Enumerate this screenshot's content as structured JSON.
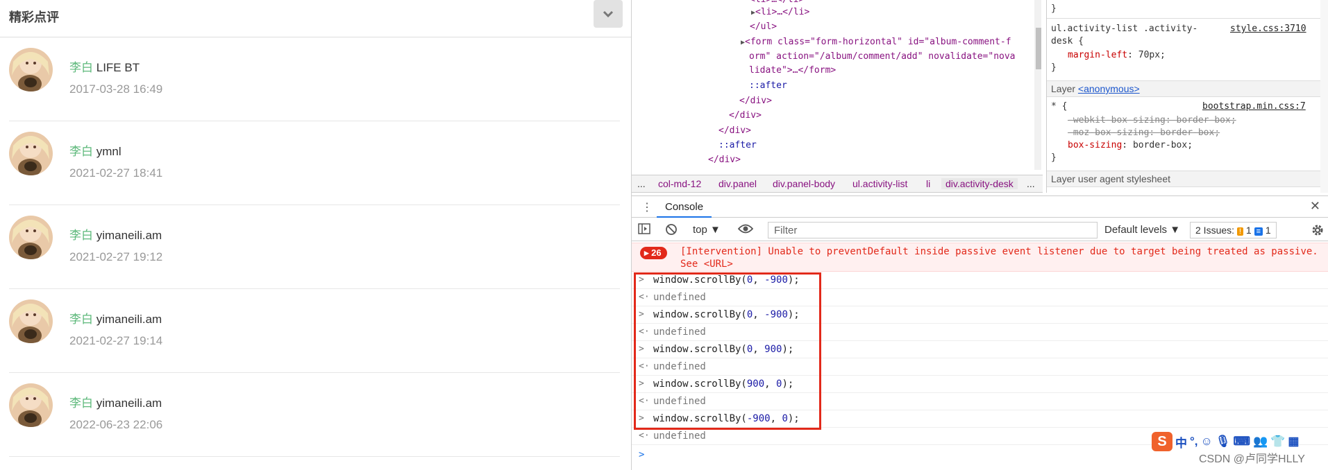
{
  "page": {
    "panel_title": "精彩点评",
    "comments": [
      {
        "user": "李白",
        "content": "LIFE BT",
        "time": "2017-03-28 16:49"
      },
      {
        "user": "李白",
        "content": "ymnl",
        "time": "2021-02-27 18:41"
      },
      {
        "user": "李白",
        "content": "yimaneili.am",
        "time": "2021-02-27 19:12"
      },
      {
        "user": "李白",
        "content": "yimaneili.am",
        "time": "2021-02-27 19:14"
      },
      {
        "user": "李白",
        "content": "yimaneili.am",
        "time": "2022-06-23 22:06"
      }
    ]
  },
  "elements": {
    "lines": [
      {
        "text": "<li>…</li>"
      },
      {
        "text": "</ul>"
      },
      {
        "form_open": "<form class=\"form-horizontal\" id=\"album-comment-f",
        "form_cont1": "orm\" action=\"/album/comment/add\" novalidate=\"nova",
        "form_cont2": "lidate\">…</form>"
      },
      {
        "text": "::after"
      },
      {
        "text": "</div>"
      },
      {
        "text": "</div>"
      },
      {
        "text": "</div>"
      },
      {
        "text": "::after"
      },
      {
        "text": "</div>"
      }
    ]
  },
  "breadcrumb": [
    "...",
    "col-md-12",
    "div.panel",
    "div.panel-body",
    "ul.activity-list",
    "li",
    "div.activity-desk",
    "..."
  ],
  "styles": {
    "rule1_selector_a": "ul.activity-list .activity-",
    "rule1_selector_b": "desk {",
    "rule1_source": "style.css:3710",
    "rule1_prop": "margin-left",
    "rule1_value": "70px;",
    "layer_anon_prefix": "Layer ",
    "layer_anon": "<anonymous>",
    "rule2_selector": "* {",
    "rule2_source": "bootstrap.min.css:7",
    "rule2_props": [
      {
        "name": "-webkit-box-sizing",
        "value": "border-box;",
        "struck": true
      },
      {
        "name": "-moz-box-sizing",
        "value": "border-box;",
        "struck": true
      },
      {
        "name": "box-sizing",
        "value": "border-box;",
        "struck": false
      }
    ],
    "layer_ua": "Layer user agent stylesheet"
  },
  "drawer": {
    "tab": "Console"
  },
  "toolbar": {
    "context": "top",
    "filter_placeholder": "Filter",
    "levels": "Default levels",
    "issues_label": "2 Issues:",
    "issues_warn": "1",
    "issues_info": "1"
  },
  "intervention": {
    "count": "26",
    "line1": "[Intervention] Unable to preventDefault inside passive event listener due to target being treated as passive.",
    "line2": "See <URL>"
  },
  "console": [
    {
      "type": "cmd",
      "text": "window.scrollBy(0, -900);"
    },
    {
      "type": "result",
      "text": "undefined"
    },
    {
      "type": "cmd",
      "text": "window.scrollBy(0, -900);"
    },
    {
      "type": "result",
      "text": "undefined"
    },
    {
      "type": "cmd",
      "text": "window.scrollBy(0, 900);"
    },
    {
      "type": "result",
      "text": "undefined"
    },
    {
      "type": "cmd",
      "text": "window.scrollBy(900, 0);"
    },
    {
      "type": "result",
      "text": "undefined"
    },
    {
      "type": "cmd",
      "text": "window.scrollBy(-900, 0);"
    },
    {
      "type": "result",
      "text": "undefined"
    }
  ],
  "overlay": {
    "ime_logo": "S",
    "ime_lang": "中",
    "watermark": "CSDN @卢同学HLLY"
  },
  "colors": {
    "username": "#5cb87a",
    "error": "#e2291a",
    "accent": "#1a73e8"
  }
}
